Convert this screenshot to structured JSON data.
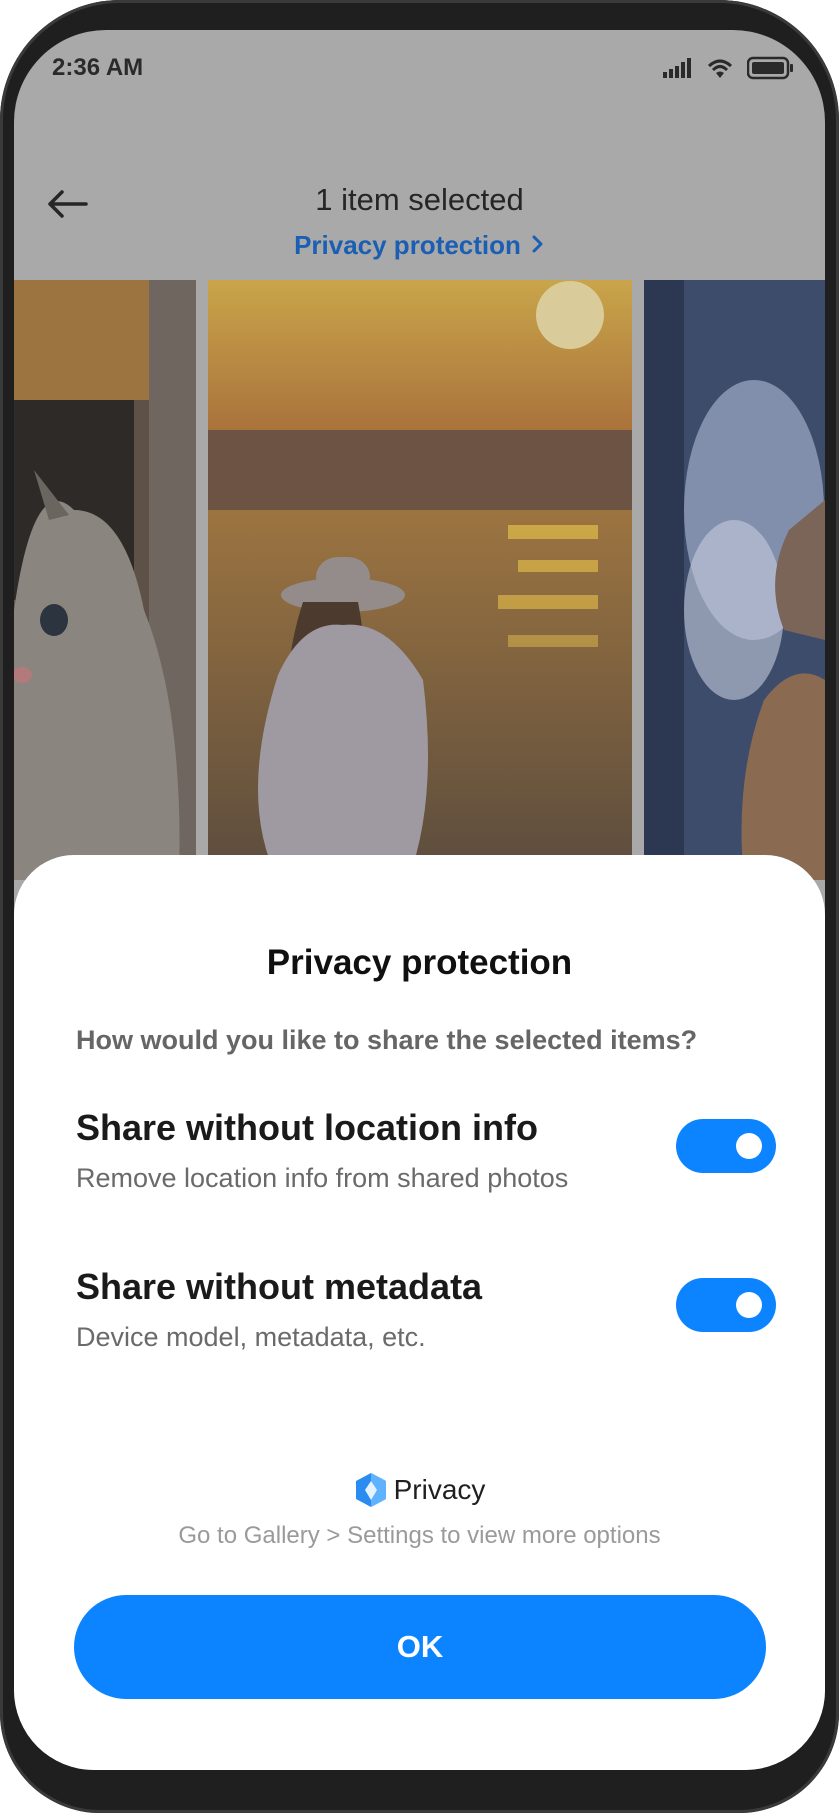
{
  "status_bar": {
    "time": "2:36 AM",
    "icons": [
      "signal-icon",
      "wifi-icon",
      "battery-icon"
    ]
  },
  "header": {
    "back_icon": "back-arrow-icon",
    "title": "1 item selected",
    "link": "Privacy protection",
    "link_icon": "chevron-right-icon"
  },
  "photos": [
    {
      "subject": "cat"
    },
    {
      "subject": "girl at sunset beach"
    },
    {
      "subject": "dog in snow"
    }
  ],
  "sheet": {
    "title": "Privacy protection",
    "question": "How would you like to share the selected items?",
    "options": [
      {
        "title": "Share without location info",
        "subtitle": "Remove location info from shared photos",
        "enabled": true
      },
      {
        "title": "Share without metadata",
        "subtitle": "Device model, metadata, etc.",
        "enabled": true
      }
    ],
    "brand_label": "Privacy",
    "brand_icon": "privacy-shield-icon",
    "hint": "Go to Gallery > Settings to view more options",
    "ok_label": "OK"
  },
  "colors": {
    "accent": "#0d84ff",
    "link": "#1a5fb4",
    "dim_overlay": "#a9a9a9"
  }
}
